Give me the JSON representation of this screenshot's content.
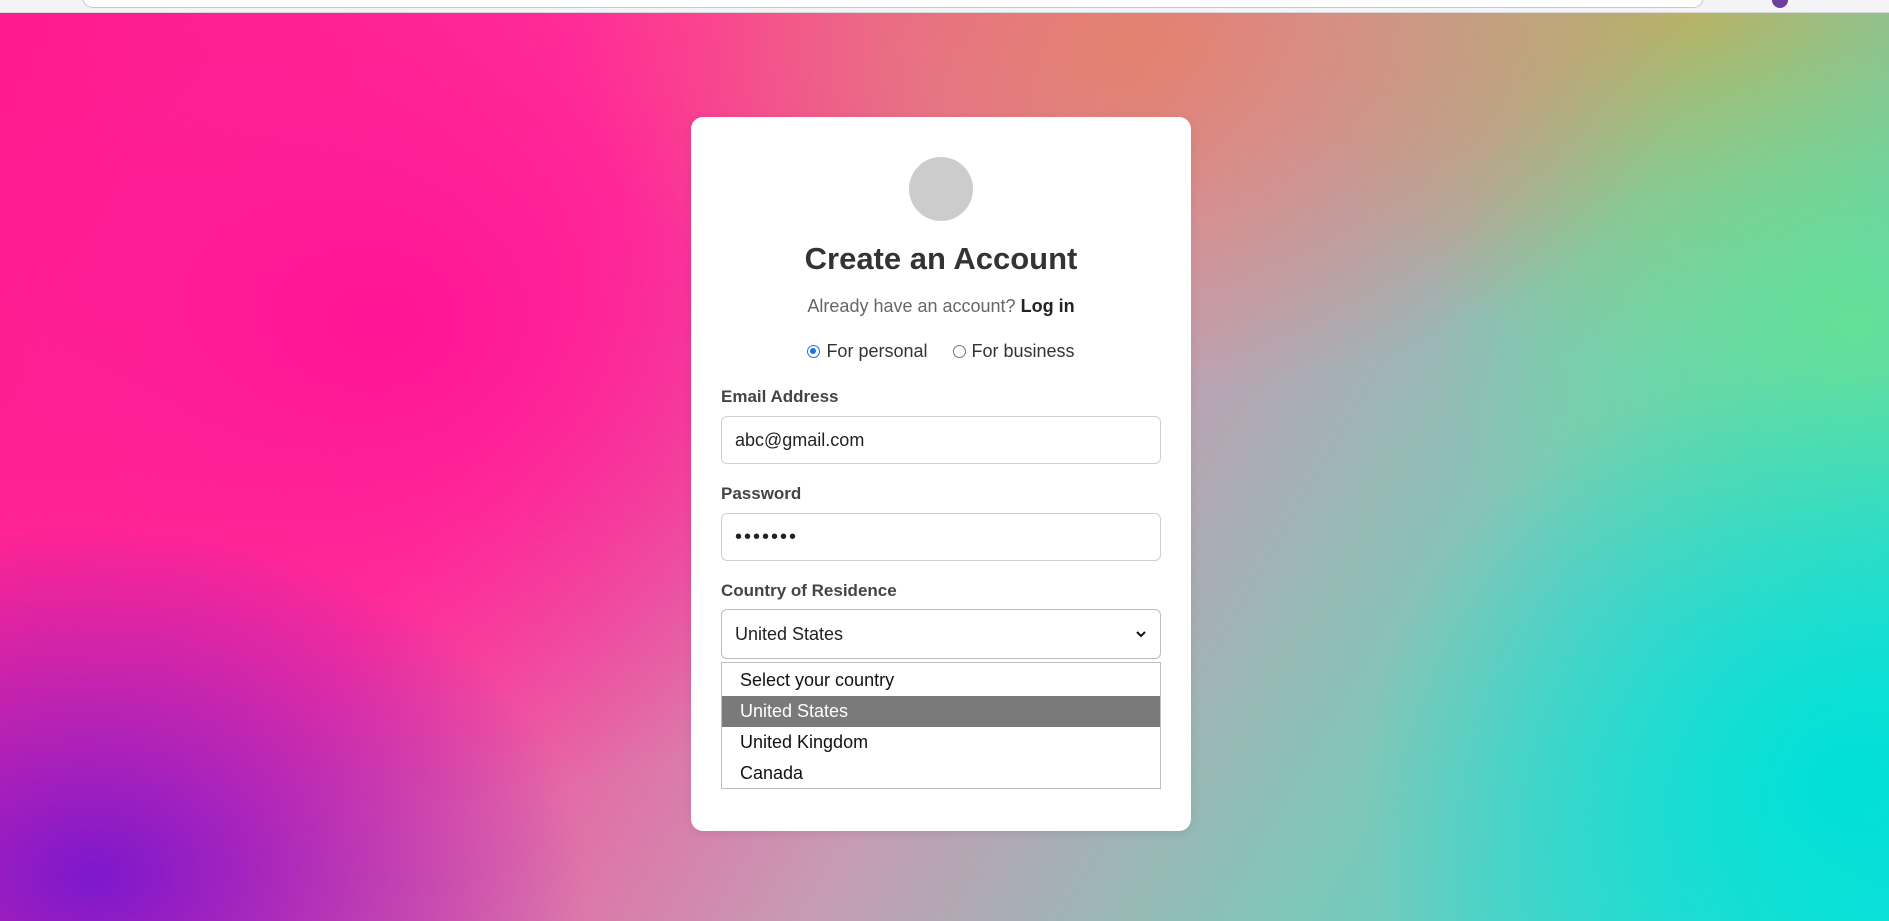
{
  "signup": {
    "title": "Create an Account",
    "login_prompt": "Already have an account?",
    "login_link": "Log in",
    "account_types": {
      "personal": "For personal",
      "business": "For business",
      "selected": "personal"
    },
    "email": {
      "label": "Email Address",
      "value": "abc@gmail.com"
    },
    "password": {
      "label": "Password",
      "value": "•••••••"
    },
    "country": {
      "label": "Country of Residence",
      "value": "United States",
      "options": [
        "Select your country",
        "United States",
        "United Kingdom",
        "Canada"
      ],
      "highlighted": "United States"
    }
  },
  "colors": {
    "card_background": "#ffffff",
    "radio_accent": "#1a73e8",
    "option_highlight": "#7a7a7a",
    "avatar_placeholder": "#cccccc"
  }
}
